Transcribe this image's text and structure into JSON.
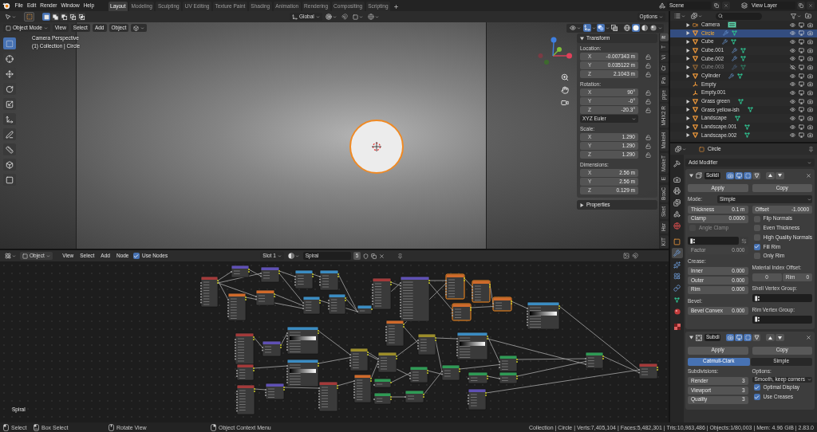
{
  "top_bar": {
    "menus": [
      "File",
      "Edit",
      "Render",
      "Window",
      "Help"
    ],
    "workspaces": [
      {
        "label": "Layout",
        "selected": true
      },
      {
        "label": "Modeling",
        "selected": false
      },
      {
        "label": "Sculpting",
        "selected": false
      },
      {
        "label": "UV Editing",
        "selected": false
      },
      {
        "label": "Texture Paint",
        "selected": false
      },
      {
        "label": "Shading",
        "selected": false
      },
      {
        "label": "Animation",
        "selected": false
      },
      {
        "label": "Rendering",
        "selected": false
      },
      {
        "label": "Compositing",
        "selected": false
      },
      {
        "label": "Scripting",
        "selected": false
      }
    ],
    "scene": "Scene",
    "view_layer": "View Layer"
  },
  "tool_header": {
    "select_modes": [
      {
        "kind": "set",
        "selected": true
      },
      {
        "kind": "extend",
        "selected": false
      },
      {
        "kind": "subtract",
        "selected": false
      },
      {
        "kind": "difference",
        "selected": false
      },
      {
        "kind": "intersect",
        "selected": false
      }
    ],
    "orientation": "Global",
    "options": "Options"
  },
  "viewport": {
    "mode": "Object Mode",
    "menus": [
      "View",
      "Select",
      "Add",
      "Object"
    ],
    "camera_label": "Camera Perspective",
    "collection_label": "(1) Collection | Circle",
    "tools": [
      {
        "kind": "select",
        "selected": true
      },
      {
        "kind": "cursor",
        "selected": false
      },
      {
        "kind": "move",
        "selected": false
      },
      {
        "kind": "rotate",
        "selected": false
      },
      {
        "kind": "scale",
        "selected": false
      },
      {
        "kind": "transform",
        "selected": false
      },
      {
        "kind": "annotate",
        "selected": false
      },
      {
        "kind": "measure",
        "selected": false
      },
      {
        "kind": "cube",
        "selected": false
      },
      {
        "kind": "frame",
        "selected": false
      }
    ],
    "overlays": [
      {
        "kind": "gizmo",
        "on": true
      },
      {
        "kind": "overlays",
        "on": true
      },
      {
        "kind": "xray",
        "on": false
      }
    ],
    "shading": [
      {
        "kind": "wireframe",
        "selected": false
      },
      {
        "kind": "solid",
        "selected": true
      },
      {
        "kind": "material",
        "selected": false
      },
      {
        "kind": "rendered",
        "selected": false
      }
    ]
  },
  "sidebar": {
    "tabs": [
      {
        "label": "It",
        "selected": true
      },
      {
        "label": "T",
        "selected": false
      },
      {
        "label": "Vi",
        "selected": false
      },
      {
        "label": "Cr",
        "selected": false
      },
      {
        "label": "Pa",
        "selected": false
      },
      {
        "label": "pipe",
        "selected": false
      },
      {
        "label": "MHX2 R",
        "selected": false
      },
      {
        "label": "MakeH",
        "selected": false
      },
      {
        "label": "MakeT",
        "selected": false
      },
      {
        "label": "E",
        "selected": false
      },
      {
        "label": "BoxC",
        "selected": false
      },
      {
        "label": "Sket",
        "selected": false
      },
      {
        "label": "Hsr",
        "selected": false
      },
      {
        "label": "KIT",
        "selected": false
      }
    ],
    "panels": [
      {
        "title": "Transform",
        "expanded": true,
        "groups": [
          {
            "label": "Location:",
            "fields": [
              {
                "axis": "X",
                "value": "-0.007343 m",
                "locked": false
              },
              {
                "axis": "Y",
                "value": "0.035122 m",
                "locked": false
              },
              {
                "axis": "Z",
                "value": "2.1043 m",
                "locked": false
              }
            ]
          },
          {
            "label": "Rotation:",
            "fields": [
              {
                "axis": "X",
                "value": "90°",
                "locked": false
              },
              {
                "axis": "Y",
                "value": "-0°",
                "locked": false
              },
              {
                "axis": "Z",
                "value": "-20.3°",
                "locked": false
              }
            ],
            "mode": "XYZ Euler"
          },
          {
            "label": "Scale:",
            "fields": [
              {
                "axis": "X",
                "value": "1.290",
                "locked": false
              },
              {
                "axis": "Y",
                "value": "1.290",
                "locked": false
              },
              {
                "axis": "Z",
                "value": "1.290",
                "locked": false
              }
            ]
          },
          {
            "label": "Dimensions:",
            "fields": [
              {
                "axis": "X",
                "value": "2.56 m"
              },
              {
                "axis": "Y",
                "value": "2.56 m"
              },
              {
                "axis": "Z",
                "value": "0.129 m"
              }
            ]
          }
        ]
      },
      {
        "title": "Properties",
        "expanded": false
      }
    ]
  },
  "outliner": {
    "rows": [
      {
        "name": "Camera",
        "kind": "camera",
        "selected": false,
        "visible": true,
        "modifiers": false
      },
      {
        "name": "Circle",
        "kind": "mesh",
        "selected": true,
        "visible": true,
        "modifiers": true
      },
      {
        "name": "Cube",
        "kind": "mesh",
        "selected": false,
        "visible": true,
        "modifiers": true
      },
      {
        "name": "Cube.001",
        "kind": "mesh",
        "selected": false,
        "visible": true,
        "modifiers": true
      },
      {
        "name": "Cube.002",
        "kind": "mesh",
        "selected": false,
        "visible": true,
        "modifiers": true
      },
      {
        "name": "Cube.003",
        "kind": "mesh",
        "selected": false,
        "visible": false,
        "modifiers": true
      },
      {
        "name": "Cylinder",
        "kind": "mesh",
        "selected": false,
        "visible": true,
        "modifiers": true
      },
      {
        "name": "Empty",
        "kind": "empty",
        "selected": false,
        "visible": true,
        "modifiers": false
      },
      {
        "name": "Empty.001",
        "kind": "empty",
        "selected": false,
        "visible": true,
        "modifiers": false
      },
      {
        "name": "Grass green",
        "kind": "mesh",
        "selected": false,
        "visible": true,
        "modifiers": false
      },
      {
        "name": "Grass yellow-ish",
        "kind": "mesh",
        "selected": false,
        "visible": true,
        "modifiers": false
      },
      {
        "name": "Landscape",
        "kind": "mesh",
        "selected": false,
        "visible": true,
        "modifiers": false
      },
      {
        "name": "Landscape.001",
        "kind": "mesh",
        "selected": false,
        "visible": true,
        "modifiers": false
      },
      {
        "name": "Landscape.002",
        "kind": "mesh",
        "selected": false,
        "visible": true,
        "modifiers": false
      }
    ]
  },
  "properties": {
    "object": "Circle",
    "tabs": [
      {
        "kind": "tool",
        "selected": false
      },
      {
        "kind": "render",
        "selected": false
      },
      {
        "kind": "output",
        "selected": false
      },
      {
        "kind": "view_layer",
        "selected": false
      },
      {
        "kind": "scene",
        "selected": false
      },
      {
        "kind": "world",
        "selected": false
      },
      {
        "kind": "object",
        "selected": false
      },
      {
        "kind": "modifiers",
        "selected": true
      },
      {
        "kind": "particles",
        "selected": false
      },
      {
        "kind": "physics",
        "selected": false
      },
      {
        "kind": "constraints",
        "selected": false
      },
      {
        "kind": "data",
        "selected": false
      },
      {
        "kind": "material",
        "selected": false
      },
      {
        "kind": "texture",
        "selected": false
      }
    ],
    "add_modifier": "Add Modifier",
    "modifiers": [
      {
        "kind": "solidify",
        "name": "Solidi",
        "expanded": true,
        "toggles": [
          {
            "kind": "render",
            "on": true
          },
          {
            "kind": "viewport",
            "on": true
          },
          {
            "kind": "edit_mode",
            "on": true
          },
          {
            "kind": "on_cage",
            "on": false
          }
        ],
        "apply": "Apply",
        "copy": "Copy",
        "wide": {
          "kind": "dropdown",
          "label": "Mode:",
          "value": "Simple"
        },
        "left": [
          {
            "kind": "number",
            "label": "Thickness",
            "value": "0.1 m",
            "disabled": false
          },
          {
            "kind": "number",
            "label": "Clamp",
            "value": "0.0000",
            "disabled": false
          },
          {
            "kind": "checkbox",
            "label": "Angle Clamp",
            "checked": false,
            "disabled": true
          },
          {
            "kind": "vertex_group",
            "invert": false
          },
          {
            "kind": "number",
            "label": "Factor",
            "value": "0.000",
            "disabled": true
          },
          {
            "kind": "heading",
            "label": "Crease:"
          },
          {
            "kind": "number",
            "label": "Inner",
            "value": "0.000",
            "disabled": false
          },
          {
            "kind": "number",
            "label": "Outer",
            "value": "0.000",
            "disabled": false
          },
          {
            "kind": "number",
            "label": "Rim",
            "value": "0.000",
            "disabled": false
          },
          {
            "kind": "heading",
            "label": "Bevel:"
          },
          {
            "kind": "number",
            "label": "Bevel Convex",
            "value": "0.000",
            "disabled": false
          }
        ],
        "right": [
          {
            "kind": "number",
            "label": "Offset",
            "value": "-1.0000",
            "disabled": false
          },
          {
            "kind": "checkbox",
            "label": "Flip Normals",
            "checked": false,
            "disabled": false
          },
          {
            "kind": "checkbox",
            "label": "Even Thickness",
            "checked": false,
            "disabled": false
          },
          {
            "kind": "checkbox",
            "label": "High Quality Normals",
            "checked": false,
            "disabled": false
          },
          {
            "kind": "checkbox",
            "label": "Fill Rim",
            "checked": true,
            "disabled": false
          },
          {
            "kind": "checkbox",
            "label": "Only Rim",
            "checked": false,
            "disabled": false
          },
          {
            "kind": "pair",
            "label": "Material Index Offset:",
            "fields": [
              {
                "value": "0"
              },
              {
                "label": "Rim",
                "value": "0"
              }
            ]
          },
          {
            "kind": "heading",
            "label": "Shell Vertex Group:"
          },
          {
            "kind": "vertex_group"
          },
          {
            "kind": "heading",
            "label": "Rim Vertex Group:"
          },
          {
            "kind": "vertex_group"
          }
        ]
      },
      {
        "kind": "subsurf",
        "name": "Subdi",
        "expanded": true,
        "toggles": [
          {
            "kind": "render",
            "on": true
          },
          {
            "kind": "viewport",
            "on": true
          },
          {
            "kind": "edit_mode",
            "on": true
          },
          {
            "kind": "on_cage",
            "on": false
          }
        ],
        "apply": "Apply",
        "copy": "Copy",
        "wide": {
          "kind": "enum",
          "options": [
            {
              "label": "Catmull-Clark",
              "selected": true
            },
            {
              "label": "Simple",
              "selected": false
            }
          ]
        },
        "left": [
          {
            "kind": "heading",
            "label": "Subdivisions:"
          },
          {
            "kind": "number",
            "label": "Render",
            "value": "3",
            "disabled": false
          },
          {
            "kind": "number",
            "label": "Viewport",
            "value": "3",
            "disabled": false
          },
          {
            "kind": "number",
            "label": "Quality",
            "value": "3",
            "disabled": false
          }
        ],
        "right": [
          {
            "kind": "heading",
            "label": "Options:"
          },
          {
            "kind": "dropdown",
            "value": "Smooth, keep corners"
          },
          {
            "kind": "checkbox",
            "label": "Optimal Display",
            "checked": true,
            "disabled": false
          },
          {
            "kind": "checkbox",
            "label": "Use Creases",
            "checked": true,
            "disabled": false
          }
        ]
      }
    ]
  },
  "node_editor": {
    "object_type": "Object",
    "menus": [
      "View",
      "Select",
      "Add",
      "Node"
    ],
    "use_nodes": {
      "label": "Use Nodes",
      "checked": true
    },
    "slot": "Slot 1",
    "material": "Spiral",
    "users": "5",
    "material_label": "Spiral",
    "nodes": [
      {
        "color": "#a33a3a",
        "selected": false
      },
      {
        "color": "#5f50b4",
        "selected": false
      },
      {
        "color": "#5f50b4",
        "selected": false
      },
      {
        "color": "#3b8cc2",
        "selected": false
      },
      {
        "color": "#3b8cc2",
        "selected": false
      },
      {
        "color": "#cf6a2b",
        "selected": false
      },
      {
        "color": "#cf6a2b",
        "selected": false
      },
      {
        "color": "#3b8cc2",
        "selected": false
      },
      {
        "color": "#3b8cc2",
        "selected": false
      },
      {
        "color": "#3b8cc2",
        "selected": false
      },
      {
        "color": "#a33a3a",
        "selected": false
      },
      {
        "color": "#5f50b4",
        "selected": false
      },
      {
        "color": "#cf6a2b",
        "selected": true
      },
      {
        "color": "#cf6a2b",
        "selected": true
      },
      {
        "color": "#cf6a2b",
        "selected": true
      },
      {
        "color": "#cf6a2b",
        "selected": true
      },
      {
        "color": "#3b8cc2",
        "selected": false
      },
      {
        "color": "#2f9a55",
        "selected": false
      },
      {
        "color": "#a33a3a",
        "selected": false
      },
      {
        "color": "#a33a3a",
        "selected": false
      },
      {
        "color": "#5f50b4",
        "selected": false
      },
      {
        "color": "#3b8cc2",
        "selected": false
      },
      {
        "color": "#a33a3a",
        "selected": false
      },
      {
        "color": "#3b8cc2",
        "selected": false
      },
      {
        "color": "#a33a3a",
        "selected": false
      },
      {
        "color": "#5f50b4",
        "selected": false
      },
      {
        "color": "#a33a3a",
        "selected": false
      },
      {
        "color": "#9c8d2a",
        "selected": false
      },
      {
        "color": "#cf6a2b",
        "selected": false
      },
      {
        "color": "#9c8d2a",
        "selected": false
      },
      {
        "color": "#cf6a2b",
        "selected": false
      },
      {
        "color": "#2f9a55",
        "selected": false
      },
      {
        "color": "#2f9a55",
        "selected": false
      },
      {
        "color": "#2f9a55",
        "selected": false
      },
      {
        "color": "#2f9a55",
        "selected": false
      },
      {
        "color": "#9c8d2a",
        "selected": false
      },
      {
        "color": "#3b8cc2",
        "selected": false
      },
      {
        "color": "#2f9a55",
        "selected": false
      },
      {
        "color": "#2f9a55",
        "selected": false
      },
      {
        "color": "#5f50b4",
        "selected": false
      },
      {
        "color": "#2f9a55",
        "selected": false
      },
      {
        "color": "#2f9a55",
        "selected": false
      }
    ]
  },
  "status_bar": {
    "hints": [
      {
        "kind": "left",
        "label": "Select"
      },
      {
        "kind": "drag",
        "label": "Box Select"
      },
      {
        "kind": "middle",
        "label": "Rotate View"
      },
      {
        "kind": "right",
        "label": "Object Context Menu"
      }
    ],
    "stats": "Collection | Circle | Verts:7,405,104 | Faces:5,482,301 | Tris:10,963,486 | Objects:1/80,003 | Mem: 4.96 GiB | 2.83.0"
  }
}
